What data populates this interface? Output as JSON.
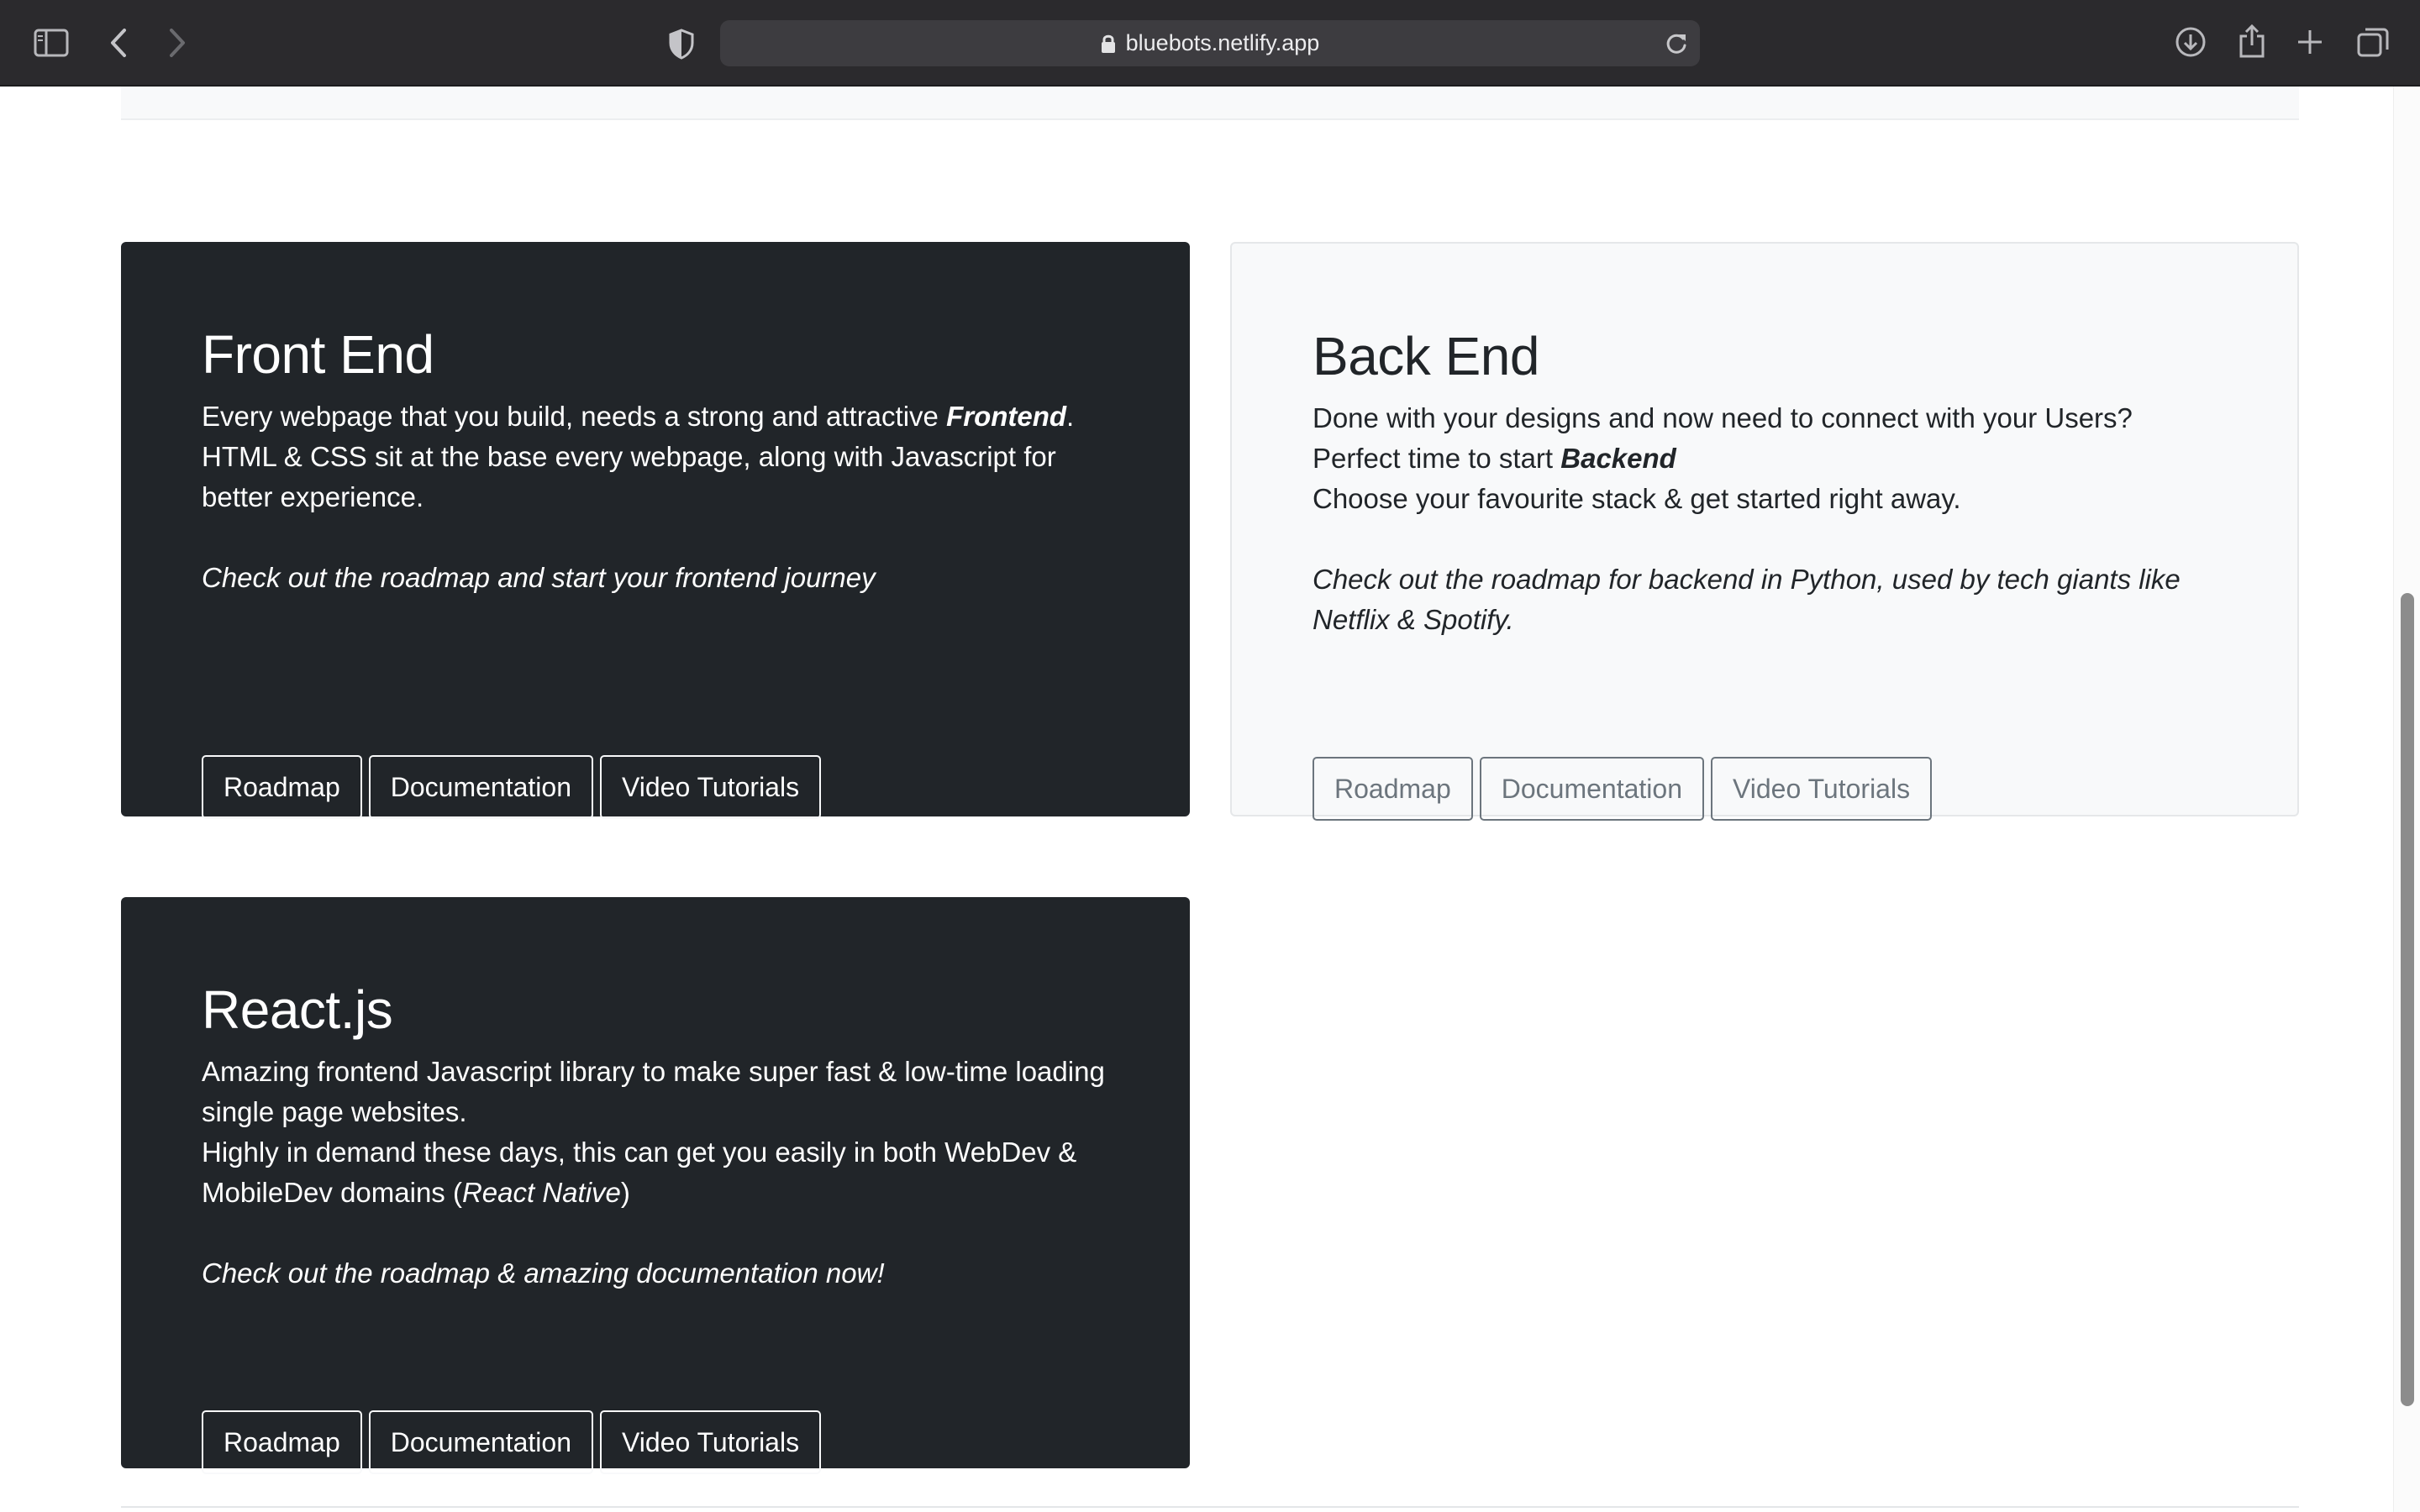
{
  "browser": {
    "url": "bluebots.netlify.app",
    "icons": {
      "sidebar": "sidebar-icon",
      "back": "chevron-left-icon",
      "forward": "chevron-right-icon",
      "privacy": "shield-icon",
      "lock": "lock-icon",
      "reload": "reload-icon",
      "download": "download-icon",
      "share": "share-icon",
      "new_tab": "plus-icon",
      "tabs": "tab-overview-icon"
    }
  },
  "cards": [
    {
      "id": "frontend",
      "theme": "dark",
      "title": "Front End",
      "text_before": "Every webpage that you build, needs a strong and attractive ",
      "text_emphasis": "Frontend",
      "text_after": ". HTML & CSS sit at the base every webpage, along with Javascript for better experience.",
      "cta": "Check out the roadmap and start your frontend journey",
      "buttons": [
        "Roadmap",
        "Documentation",
        "Video Tutorials"
      ]
    },
    {
      "id": "backend",
      "theme": "light",
      "title": "Back End",
      "line1": "Done with your designs and now need to connect with your Users?",
      "line2_before": "Perfect time to start ",
      "line2_emphasis": "Backend",
      "line3": "Choose your favourite stack & get started right away.",
      "cta": "Check out the roadmap for backend in Python, used by tech giants like Netflix & Spotify.",
      "buttons": [
        "Roadmap",
        "Documentation",
        "Video Tutorials"
      ]
    },
    {
      "id": "react",
      "theme": "dark",
      "title": "React.js",
      "para1": "Amazing frontend Javascript library to make super fast & low-time loading single page websites.",
      "para2_before": "Highly in demand these days, this can get you easily in both WebDev & MobileDev domains (",
      "para2_emphasis": "React Native",
      "para2_after": ")",
      "cta": "Check out the roadmap & amazing documentation now!",
      "buttons": [
        "Roadmap",
        "Documentation",
        "Video Tutorials"
      ]
    }
  ],
  "colors": {
    "dark_card": "#212529",
    "light_card": "#f8f9fa",
    "toolbar": "#2b2a2d"
  }
}
